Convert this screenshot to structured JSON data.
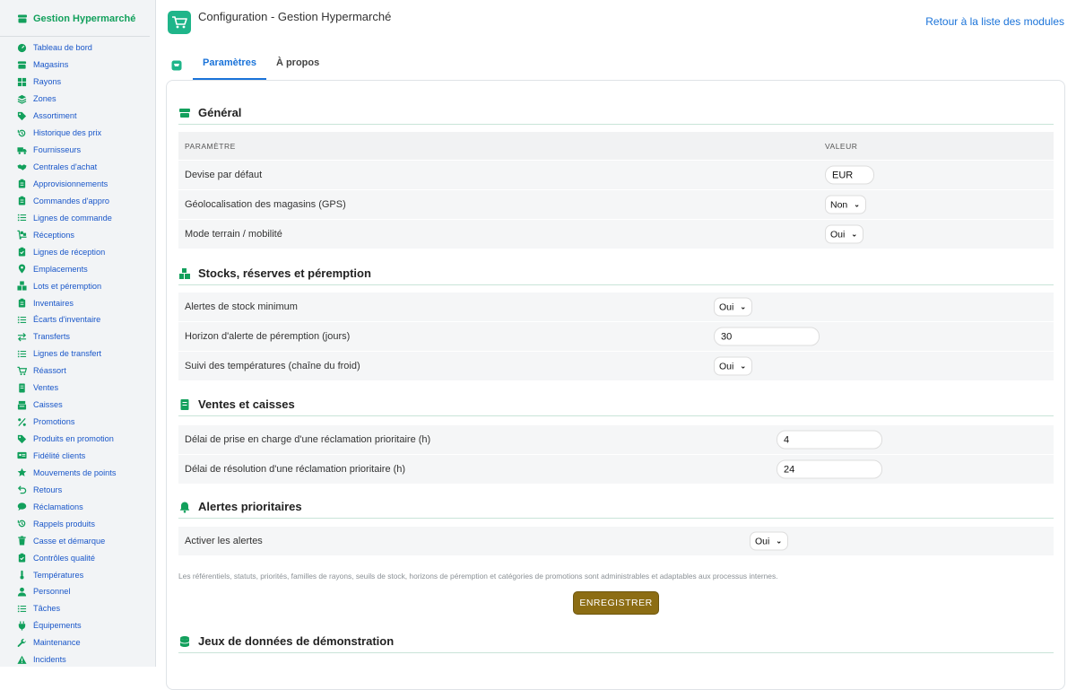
{
  "sidebar": {
    "brand": "Gestion Hypermarché",
    "items": [
      {
        "label": "Tableau de bord",
        "icon": "gauge-icon"
      },
      {
        "label": "Magasins",
        "icon": "store-icon"
      },
      {
        "label": "Rayons",
        "icon": "grid-icon"
      },
      {
        "label": "Zones",
        "icon": "layers-icon"
      },
      {
        "label": "Assortiment",
        "icon": "tag-icon"
      },
      {
        "label": "Historique des prix",
        "icon": "history-icon"
      },
      {
        "label": "Fournisseurs",
        "icon": "truck-icon"
      },
      {
        "label": "Centrales d'achat",
        "icon": "handshake-icon"
      },
      {
        "label": "Approvisionnements",
        "icon": "clipboard-icon"
      },
      {
        "label": "Commandes d'appro",
        "icon": "clipboard-icon"
      },
      {
        "label": "Lignes de commande",
        "icon": "list-icon"
      },
      {
        "label": "Réceptions",
        "icon": "dolly-icon"
      },
      {
        "label": "Lignes de réception",
        "icon": "clipboard-check-icon"
      },
      {
        "label": "Emplacements",
        "icon": "map-pin-icon"
      },
      {
        "label": "Lots et péremption",
        "icon": "boxes-icon"
      },
      {
        "label": "Inventaires",
        "icon": "clipboard-icon"
      },
      {
        "label": "Écarts d'inventaire",
        "icon": "list-icon"
      },
      {
        "label": "Transferts",
        "icon": "transfer-icon"
      },
      {
        "label": "Lignes de transfert",
        "icon": "list-icon"
      },
      {
        "label": "Réassort",
        "icon": "cart-icon"
      },
      {
        "label": "Ventes",
        "icon": "receipt-icon"
      },
      {
        "label": "Caisses",
        "icon": "cash-register-icon"
      },
      {
        "label": "Promotions",
        "icon": "percent-icon"
      },
      {
        "label": "Produits en promotion",
        "icon": "tag-icon"
      },
      {
        "label": "Fidélité clients",
        "icon": "id-card-icon"
      },
      {
        "label": "Mouvements de points",
        "icon": "star-icon"
      },
      {
        "label": "Retours",
        "icon": "undo-icon"
      },
      {
        "label": "Réclamations",
        "icon": "comment-icon"
      },
      {
        "label": "Rappels produits",
        "icon": "history-icon"
      },
      {
        "label": "Casse et démarque",
        "icon": "trash-icon"
      },
      {
        "label": "Contrôles qualité",
        "icon": "clipboard-check-icon"
      },
      {
        "label": "Températures",
        "icon": "thermometer-icon"
      },
      {
        "label": "Personnel",
        "icon": "user-icon"
      },
      {
        "label": "Tâches",
        "icon": "list-icon"
      },
      {
        "label": "Équipements",
        "icon": "plug-icon"
      },
      {
        "label": "Maintenance",
        "icon": "wrench-icon"
      },
      {
        "label": "Incidents",
        "icon": "warning-icon"
      }
    ]
  },
  "header": {
    "title": "Configuration - Gestion Hypermarché",
    "back_link": "Retour à la liste des modules"
  },
  "tabs": {
    "settings": "Paramètres",
    "about": "À propos"
  },
  "sections": {
    "general": {
      "title": "Général",
      "col_param": "PARAMÈTRE",
      "col_value": "VALEUR",
      "rows": [
        {
          "label": "Devise par défaut",
          "value": "EUR"
        },
        {
          "label": "Géolocalisation des magasins (GPS)",
          "value": "Non"
        },
        {
          "label": "Mode terrain / mobilité",
          "value": "Oui"
        }
      ]
    },
    "stocks": {
      "title": "Stocks, réserves et péremption",
      "rows": [
        {
          "label": "Alertes de stock minimum",
          "value": "Oui"
        },
        {
          "label": "Horizon d'alerte de péremption (jours)",
          "value": "30"
        },
        {
          "label": "Suivi des températures (chaîne du froid)",
          "value": "Oui"
        }
      ]
    },
    "sales": {
      "title": "Ventes et caisses",
      "rows": [
        {
          "label": "Délai de prise en charge d'une réclamation prioritaire (h)",
          "value": "4"
        },
        {
          "label": "Délai de résolution d'une réclamation prioritaire (h)",
          "value": "24"
        }
      ]
    },
    "alerts": {
      "title": "Alertes prioritaires",
      "rows": [
        {
          "label": "Activer les alertes",
          "value": "Oui"
        }
      ]
    },
    "demo": {
      "title": "Jeux de données de démonstration"
    }
  },
  "note": "Les référentiels, statuts, priorités, familles de rayons, seuils de stock, horizons de péremption et catégories de promotions sont administrables et adaptables aux processus internes.",
  "save_button": "ENREGISTRER",
  "colors": {
    "brand_green": "#12a05c",
    "link_blue": "#1a57c9",
    "tab_blue": "#1a73d9",
    "save_bg": "#8c6d14"
  }
}
